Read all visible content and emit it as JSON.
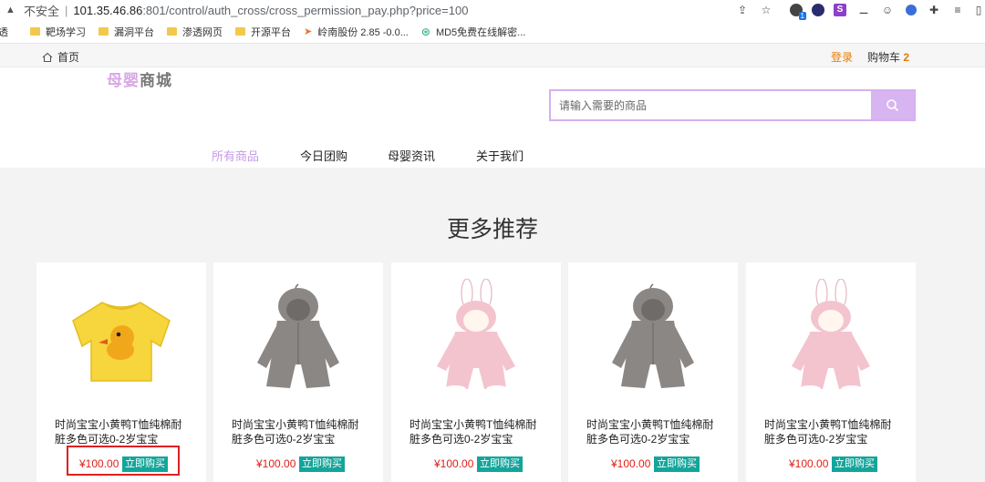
{
  "browser": {
    "insecure_label": "不安全",
    "url_host": "101.35.46.86",
    "url_path": ":801/control/auth_cross/cross_permission_pay.php?price=100",
    "extension_badge": "1",
    "extension_s": "S"
  },
  "bookmarks": [
    {
      "label": "透"
    },
    {
      "label": "靶场学习"
    },
    {
      "label": "漏洞平台"
    },
    {
      "label": "渗透网页"
    },
    {
      "label": "开源平台"
    },
    {
      "label": "岭南股份 2.85 -0.0..."
    },
    {
      "label": "MD5免费在线解密..."
    }
  ],
  "topnav": {
    "home": "首页",
    "login": "登录",
    "cart_label": "购物车",
    "cart_count": "2"
  },
  "header": {
    "logo_prefix": "母婴",
    "logo_suffix": "商城",
    "search_placeholder": "请输入需要的商品"
  },
  "nav": [
    {
      "label": "所有商品",
      "active": true
    },
    {
      "label": "今日团购",
      "active": false
    },
    {
      "label": "母婴资讯",
      "active": false
    },
    {
      "label": "关于我们",
      "active": false
    }
  ],
  "section": {
    "title": "更多推荐"
  },
  "products": [
    {
      "name": "时尚宝宝小黄鸭T恤纯棉耐脏多色可选0-2岁宝宝",
      "price": "¥100.00",
      "buy": "立即购买",
      "image": "yellow-duck-tshirt"
    },
    {
      "name": "时尚宝宝小黄鸭T恤纯棉耐脏多色可选0-2岁宝宝",
      "price": "¥100.00",
      "buy": "立即购买",
      "image": "gray-hooded-romper"
    },
    {
      "name": "时尚宝宝小黄鸭T恤纯棉耐脏多色可选0-2岁宝宝",
      "price": "¥100.00",
      "buy": "立即购买",
      "image": "pink-bunny-romper"
    },
    {
      "name": "时尚宝宝小黄鸭T恤纯棉耐脏多色可选0-2岁宝宝",
      "price": "¥100.00",
      "buy": "立即购买",
      "image": "gray-hooded-romper"
    },
    {
      "name": "时尚宝宝小黄鸭T恤纯棉耐脏多色可选0-2岁宝宝",
      "price": "¥100.00",
      "buy": "立即购买",
      "image": "pink-bunny-romper"
    }
  ],
  "colors": {
    "accent": "#d8b4f0",
    "price": "#e0201a",
    "buy": "#13a59b",
    "login": "#e87a00",
    "highlight": "#e02020"
  }
}
